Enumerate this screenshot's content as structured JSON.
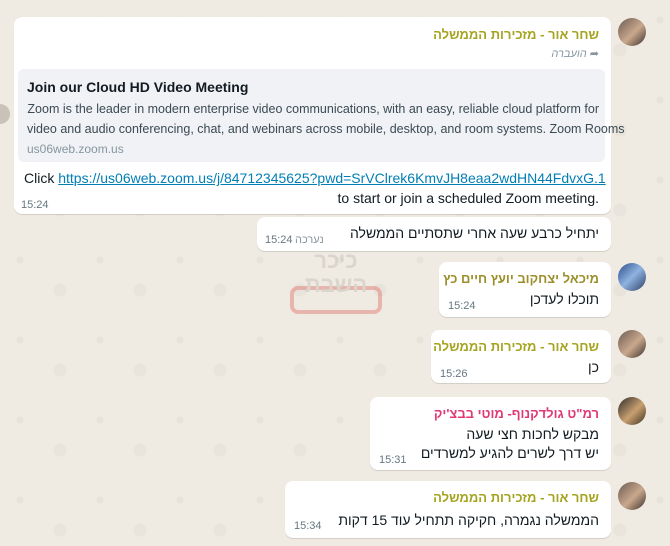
{
  "messages": [
    {
      "sender": "שחר אור - מזכירות הממשלה",
      "forwarded": "הועברה",
      "preview": {
        "title": "Join our Cloud HD Video Meeting",
        "description_line1": "Zoom is the leader in modern enterprise video communications, with an easy, reliable cloud platform for",
        "description_line2": "video and audio conferencing, chat, and webinars across mobile, desktop, and room systems. Zoom Rooms",
        "domain": "us06web.zoom.us"
      },
      "text_prefix": "Click ",
      "link": "https://us06web.zoom.us/j/84712345625?pwd=SrVClrek6KmvJH8eaa2wdHN44FdvxG.1",
      "text_line2": "to start or join a scheduled Zoom meeting.",
      "time": "15:24"
    },
    {
      "text": "יתחיל כרבע שעה אחרי שתסתיים הממשלה",
      "read_label": "נערכה",
      "time": "15:24"
    },
    {
      "sender": "מיכאל יצחקוב יועץ חיים כץ",
      "text": "תוכלו לעדכן",
      "time": "15:24"
    },
    {
      "sender": "שחר אור - מזכירות הממשלה",
      "text": "כן",
      "time": "15:26"
    },
    {
      "sender": "רמ\"ט גולדקנוף- מוטי בבצ'יק",
      "line1": "מבקש לחכות חצי שעה",
      "line2": "יש דרך לשרים להגיע למשרדים",
      "time": "15:31"
    },
    {
      "sender": "שחר אור - מזכירות הממשלה",
      "text": "הממשלה נגמרה, חקיקה תתחיל עוד 15 דקות",
      "time": "15:34"
    }
  ],
  "watermark": {
    "line1": "כיכר",
    "line2": "השבת"
  },
  "colors": {
    "sender_green": "#a5a31f",
    "sender_olive": "#9c8f2b",
    "sender_pink": "#e03775",
    "link": "#027eb5",
    "background": "#efeae2"
  }
}
